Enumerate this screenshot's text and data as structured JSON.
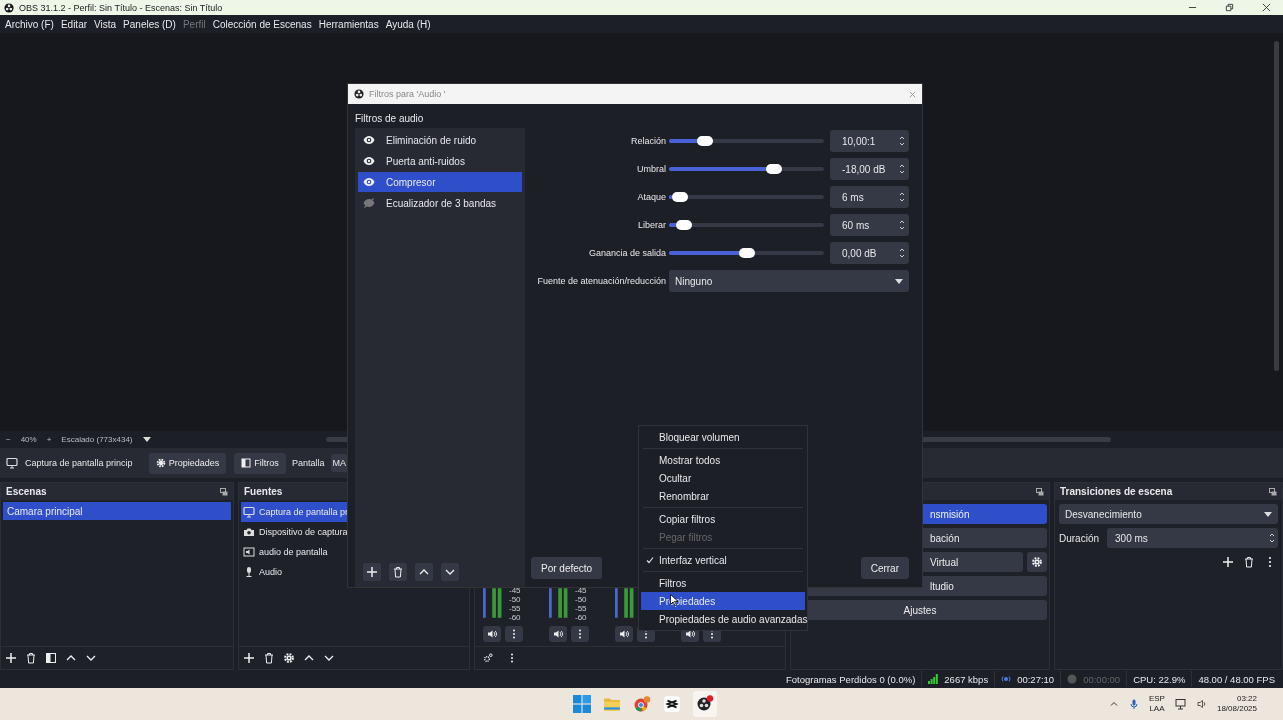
{
  "window": {
    "title": "OBS 31.1.2 - Perfil: Sin Título - Escenas: Sin Título"
  },
  "menu_bar": [
    {
      "label": "Archivo (F)",
      "disabled": false
    },
    {
      "label": "Editar",
      "disabled": false
    },
    {
      "label": "Vista",
      "disabled": false
    },
    {
      "label": "Paneles (D)",
      "disabled": false
    },
    {
      "label": "Perfil",
      "disabled": true
    },
    {
      "label": "Colección de Escenas",
      "disabled": false
    },
    {
      "label": "Herramientas",
      "disabled": false
    },
    {
      "label": "Ayuda (H)",
      "disabled": false
    }
  ],
  "preview_toolbar": {
    "zoom_out": "−",
    "zoom": "40%",
    "zoom_in": "+",
    "scale": "Escalado (773x434)"
  },
  "source_bar": {
    "source": "Captura de pantalla princip",
    "properties": "Propiedades",
    "filters": "Filtros",
    "display_label": "Pantalla",
    "display_value": "MA"
  },
  "scenes": {
    "title": "Escenas",
    "items": [
      {
        "label": "Camara principal",
        "selected": true
      }
    ]
  },
  "sources": {
    "title": "Fuentes",
    "items": [
      {
        "label": "Captura de pantalla pr",
        "kind": "display",
        "selected": true
      },
      {
        "label": "Dispositivo de captura",
        "kind": "camera",
        "selected": false
      },
      {
        "label": "audio de pantalla",
        "kind": "audio-output",
        "selected": false
      },
      {
        "label": "Audio",
        "kind": "mic",
        "selected": false
      }
    ]
  },
  "mixer": {
    "channels": [
      {
        "kind": "meter",
        "scale": [
          "-45",
          "-50",
          "-55",
          "-60"
        ]
      },
      {
        "kind": "meter",
        "scale": [
          "-45",
          "-50",
          "-55",
          "-60"
        ]
      },
      {
        "kind": "meter"
      },
      {
        "kind": "buttons"
      }
    ]
  },
  "controls": {
    "buttons": [
      {
        "label": "nsmisión",
        "kind": "cut",
        "active": true,
        "settings": false
      },
      {
        "label": "bación",
        "kind": "cut",
        "active": false,
        "settings": false
      },
      {
        "label": "Virtual",
        "kind": "cut",
        "active": false,
        "settings": true
      },
      {
        "label": "ltudio",
        "kind": "cut",
        "active": false,
        "settings": false
      },
      {
        "label": "Ajustes",
        "kind": "full",
        "active": false,
        "settings": false
      }
    ]
  },
  "transitions": {
    "title": "Transiciones de escena",
    "transition": "Desvanecimiento",
    "duration_label": "Duración",
    "duration": "300 ms"
  },
  "dialog": {
    "title": "Filtros para 'Audio '",
    "section": "Filtros de audio",
    "filters": [
      {
        "label": "Eliminación de ruido",
        "enabled": true,
        "selected": false
      },
      {
        "label": "Puerta anti-ruidos",
        "enabled": true,
        "selected": false
      },
      {
        "label": "Compresor",
        "enabled": true,
        "selected": true
      },
      {
        "label": "Ecualizador de 3 bandas",
        "enabled": false,
        "selected": false
      }
    ],
    "settings": [
      {
        "kind": "slider",
        "label": "Relación",
        "level": 0.2,
        "value": "10,00:1"
      },
      {
        "kind": "slider",
        "label": "Umbral",
        "level": 0.7,
        "value": "-18,00 dB"
      },
      {
        "kind": "slider",
        "label": "Ataque",
        "level": 0.02,
        "value": "6 ms"
      },
      {
        "kind": "slider",
        "label": "Liberar",
        "level": 0.05,
        "value": "60 ms"
      },
      {
        "kind": "slider",
        "label": "Ganancia de salida",
        "level": 0.5,
        "value": "0,00 dB"
      },
      {
        "kind": "dropdown",
        "label": "Fuente de atenuación/reducción",
        "value": "Ninguno"
      }
    ],
    "defaults_button": "Por defecto",
    "close_button": "Cerrar"
  },
  "context_menu": {
    "groups": [
      [
        {
          "label": "Bloquear volumen",
          "checked": false,
          "disabled": false,
          "selected": false
        }
      ],
      [
        {
          "label": "Mostrar todos",
          "checked": false,
          "disabled": false,
          "selected": false
        },
        {
          "label": "Ocultar",
          "checked": false,
          "disabled": false,
          "selected": false
        },
        {
          "label": "Renombrar",
          "checked": false,
          "disabled": false,
          "selected": false
        }
      ],
      [
        {
          "label": "Copiar filtros",
          "checked": false,
          "disabled": false,
          "selected": false
        },
        {
          "label": "Pegar filtros",
          "checked": false,
          "disabled": true,
          "selected": false
        }
      ],
      [
        {
          "label": "Interfaz vertical",
          "checked": true,
          "disabled": false,
          "selected": false
        }
      ],
      [
        {
          "label": "Filtros",
          "checked": false,
          "disabled": false,
          "selected": false
        },
        {
          "label": "Propiedades",
          "checked": false,
          "disabled": false,
          "selected": true
        },
        {
          "label": "Propiedades de audio avanzadas",
          "checked": false,
          "disabled": false,
          "selected": false
        }
      ]
    ]
  },
  "status_bar": {
    "dropped": "Fotogramas Perdidos 0 (0.0%)",
    "bitrate": "2667 kbps",
    "stream_time": "00:27:10",
    "rec_time": "00:00:00",
    "recording": false,
    "cpu": "CPU: 22.9%",
    "fps": "48.00 / 48.00 FPS"
  },
  "taskbar": {
    "lang_1": "ESP",
    "lang_2": "LAA",
    "time": "03:22",
    "date": "18/08/2025"
  }
}
